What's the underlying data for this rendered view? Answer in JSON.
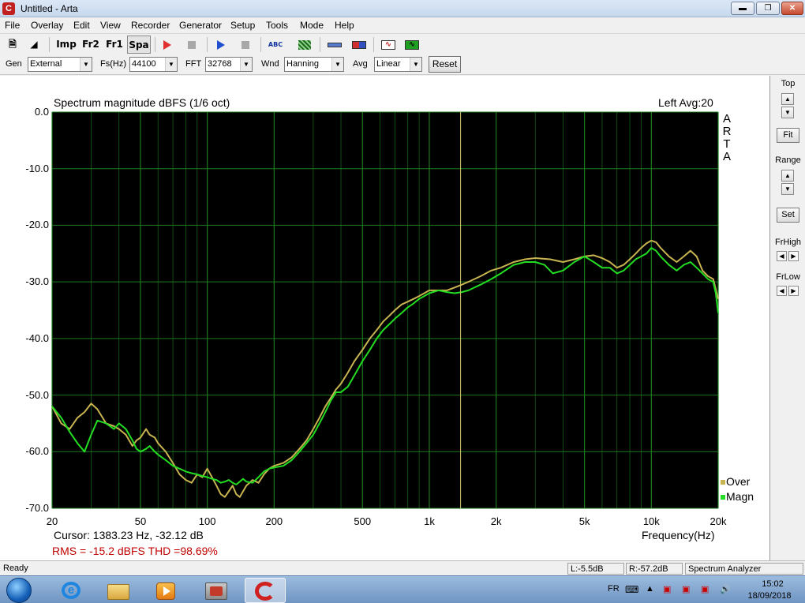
{
  "window": {
    "title": "Untitled - Arta",
    "app_icon": "arta-logo-icon"
  },
  "menu": [
    "File",
    "Overlay",
    "Edit",
    "View",
    "Recorder",
    "Generator",
    "Setup",
    "Tools",
    "Mode",
    "Help"
  ],
  "toolbar": {
    "imp_label": "Imp",
    "fr2_label": "Fr2",
    "fr1_label": "Fr1",
    "spa_label": "Spa",
    "abc_label": "ABC"
  },
  "controls": {
    "gen_label": "Gen",
    "gen_value": "External",
    "fs_label": "Fs(Hz)",
    "fs_value": "44100",
    "fft_label": "FFT",
    "fft_value": "32768",
    "wnd_label": "Wnd",
    "wnd_value": "Hanning",
    "avg_label": "Avg",
    "avg_value": "Linear",
    "reset_label": "Reset"
  },
  "plot": {
    "title": "Spectrum magnitude dBFS (1/6 oct)",
    "channel": "Left  Avg:20",
    "logo_letters": [
      "A",
      "R",
      "T",
      "A"
    ],
    "cursor_readout": "Cursor:  1383.23 Hz, -32.12 dB",
    "rms_readout": "RMS =  -15.2 dBFS   THD =98.69%",
    "colors": {
      "background": "#000000",
      "grid": "#1e7a1e",
      "over": "#c8b450",
      "magn": "#22dd22",
      "cursor": "#d8c870"
    }
  },
  "chart_data": {
    "type": "line",
    "title": "Spectrum magnitude dBFS (1/6 oct)",
    "xlabel": "Frequency(Hz)",
    "ylabel": "",
    "x_scale": "log",
    "xlim": [
      20,
      20000
    ],
    "ylim": [
      -70,
      0
    ],
    "x_ticks": [
      20,
      50,
      100,
      200,
      500,
      1000,
      2000,
      5000,
      10000,
      20000
    ],
    "x_tick_labels": [
      "20",
      "50",
      "100",
      "200",
      "500",
      "1k",
      "2k",
      "5k",
      "10k",
      "20k"
    ],
    "y_ticks": [
      0,
      -10,
      -20,
      -30,
      -40,
      -50,
      -60,
      -70
    ],
    "y_tick_labels": [
      "0.0",
      "-10.0",
      "-20.0",
      "-30.0",
      "-40.0",
      "-50.0",
      "-60.0",
      "-70.0"
    ],
    "grid": true,
    "legend_position": "bottom-right",
    "cursor_x": 1383.23,
    "series": [
      {
        "name": "Over",
        "color": "#c8b450",
        "points": [
          [
            20,
            -52
          ],
          [
            22,
            -55
          ],
          [
            24,
            -56
          ],
          [
            26,
            -54
          ],
          [
            28,
            -53
          ],
          [
            30,
            -51.5
          ],
          [
            32,
            -52.5
          ],
          [
            35,
            -55
          ],
          [
            38,
            -55.5
          ],
          [
            40,
            -56
          ],
          [
            43,
            -57
          ],
          [
            46,
            -59
          ],
          [
            48,
            -58
          ],
          [
            50,
            -57.5
          ],
          [
            53,
            -56
          ],
          [
            55,
            -57
          ],
          [
            58,
            -57.5
          ],
          [
            60,
            -58.5
          ],
          [
            65,
            -60
          ],
          [
            70,
            -62
          ],
          [
            75,
            -64
          ],
          [
            80,
            -65
          ],
          [
            85,
            -65.5
          ],
          [
            90,
            -64
          ],
          [
            95,
            -64.5
          ],
          [
            100,
            -63
          ],
          [
            105,
            -64.5
          ],
          [
            110,
            -66
          ],
          [
            115,
            -67.5
          ],
          [
            120,
            -68
          ],
          [
            125,
            -67
          ],
          [
            130,
            -66
          ],
          [
            135,
            -67.5
          ],
          [
            140,
            -68
          ],
          [
            145,
            -67
          ],
          [
            150,
            -66
          ],
          [
            160,
            -65
          ],
          [
            170,
            -65.5
          ],
          [
            180,
            -64
          ],
          [
            190,
            -63
          ],
          [
            200,
            -62.5
          ],
          [
            220,
            -62
          ],
          [
            240,
            -61
          ],
          [
            260,
            -59.5
          ],
          [
            280,
            -58
          ],
          [
            300,
            -56
          ],
          [
            320,
            -54
          ],
          [
            340,
            -52
          ],
          [
            360,
            -50.5
          ],
          [
            380,
            -49
          ],
          [
            400,
            -48
          ],
          [
            430,
            -46
          ],
          [
            460,
            -44
          ],
          [
            500,
            -42
          ],
          [
            540,
            -40
          ],
          [
            580,
            -38.5
          ],
          [
            620,
            -37
          ],
          [
            660,
            -36
          ],
          [
            700,
            -35
          ],
          [
            750,
            -34
          ],
          [
            800,
            -33.5
          ],
          [
            850,
            -33
          ],
          [
            900,
            -32.5
          ],
          [
            1000,
            -31.5
          ],
          [
            1100,
            -31.5
          ],
          [
            1200,
            -31.5
          ],
          [
            1300,
            -31
          ],
          [
            1400,
            -30.5
          ],
          [
            1500,
            -30
          ],
          [
            1700,
            -29
          ],
          [
            1900,
            -28
          ],
          [
            2100,
            -27.5
          ],
          [
            2400,
            -26.5
          ],
          [
            2700,
            -26
          ],
          [
            3000,
            -25.8
          ],
          [
            3500,
            -26
          ],
          [
            4000,
            -26.5
          ],
          [
            4500,
            -26
          ],
          [
            5000,
            -25.5
          ],
          [
            5500,
            -25.3
          ],
          [
            6000,
            -25.8
          ],
          [
            6500,
            -26.5
          ],
          [
            7000,
            -27.5
          ],
          [
            7500,
            -27
          ],
          [
            8000,
            -26
          ],
          [
            8500,
            -25
          ],
          [
            9000,
            -24
          ],
          [
            9500,
            -23.2
          ],
          [
            10000,
            -22.7
          ],
          [
            10500,
            -23
          ],
          [
            11000,
            -24
          ],
          [
            12000,
            -25.5
          ],
          [
            13000,
            -26.5
          ],
          [
            14000,
            -25.5
          ],
          [
            15000,
            -24.5
          ],
          [
            16000,
            -25.5
          ],
          [
            17000,
            -28
          ],
          [
            18000,
            -29
          ],
          [
            19000,
            -29.5
          ],
          [
            20000,
            -33
          ]
        ]
      },
      {
        "name": "Magn",
        "color": "#22dd22",
        "points": [
          [
            20,
            -52
          ],
          [
            22,
            -54
          ],
          [
            24,
            -56.5
          ],
          [
            26,
            -58.5
          ],
          [
            28,
            -60
          ],
          [
            30,
            -57
          ],
          [
            32,
            -54.5
          ],
          [
            35,
            -55
          ],
          [
            38,
            -56
          ],
          [
            40,
            -55
          ],
          [
            43,
            -56
          ],
          [
            46,
            -58
          ],
          [
            48,
            -59.5
          ],
          [
            50,
            -60
          ],
          [
            53,
            -59.5
          ],
          [
            55,
            -59
          ],
          [
            58,
            -60
          ],
          [
            60,
            -60.5
          ],
          [
            65,
            -61.5
          ],
          [
            70,
            -62.5
          ],
          [
            75,
            -63
          ],
          [
            80,
            -63.5
          ],
          [
            85,
            -63.8
          ],
          [
            90,
            -64
          ],
          [
            95,
            -64.3
          ],
          [
            100,
            -64.5
          ],
          [
            105,
            -64.8
          ],
          [
            110,
            -65
          ],
          [
            115,
            -65.5
          ],
          [
            120,
            -65.3
          ],
          [
            125,
            -65
          ],
          [
            130,
            -65.5
          ],
          [
            135,
            -65.8
          ],
          [
            140,
            -65.3
          ],
          [
            145,
            -64.8
          ],
          [
            150,
            -65.3
          ],
          [
            160,
            -65.5
          ],
          [
            170,
            -64.5
          ],
          [
            180,
            -63.5
          ],
          [
            190,
            -63
          ],
          [
            200,
            -62.8
          ],
          [
            220,
            -62.5
          ],
          [
            240,
            -61.5
          ],
          [
            260,
            -60
          ],
          [
            280,
            -58.5
          ],
          [
            300,
            -57
          ],
          [
            320,
            -55
          ],
          [
            340,
            -53
          ],
          [
            360,
            -51
          ],
          [
            380,
            -49.5
          ],
          [
            400,
            -49.5
          ],
          [
            430,
            -48.5
          ],
          [
            460,
            -46.5
          ],
          [
            500,
            -44
          ],
          [
            540,
            -42
          ],
          [
            580,
            -40
          ],
          [
            620,
            -38.5
          ],
          [
            660,
            -37.5
          ],
          [
            700,
            -36.5
          ],
          [
            750,
            -35.5
          ],
          [
            800,
            -34.5
          ],
          [
            850,
            -33.8
          ],
          [
            900,
            -33
          ],
          [
            1000,
            -32
          ],
          [
            1100,
            -31.5
          ],
          [
            1200,
            -31.8
          ],
          [
            1300,
            -32
          ],
          [
            1400,
            -31.8
          ],
          [
            1500,
            -31.5
          ],
          [
            1700,
            -30.5
          ],
          [
            1900,
            -29.5
          ],
          [
            2100,
            -28.5
          ],
          [
            2400,
            -27
          ],
          [
            2700,
            -26.5
          ],
          [
            3000,
            -26.5
          ],
          [
            3300,
            -27
          ],
          [
            3600,
            -28.5
          ],
          [
            4000,
            -28
          ],
          [
            4500,
            -26.5
          ],
          [
            5000,
            -25.5
          ],
          [
            5500,
            -26.5
          ],
          [
            6000,
            -27.5
          ],
          [
            6500,
            -27.5
          ],
          [
            7000,
            -28.5
          ],
          [
            7500,
            -28
          ],
          [
            8000,
            -27
          ],
          [
            8500,
            -26
          ],
          [
            9000,
            -25.5
          ],
          [
            9500,
            -25
          ],
          [
            10000,
            -24
          ],
          [
            10500,
            -24.5
          ],
          [
            11000,
            -25.5
          ],
          [
            12000,
            -27
          ],
          [
            13000,
            -28
          ],
          [
            14000,
            -27
          ],
          [
            15000,
            -26.5
          ],
          [
            16000,
            -27.5
          ],
          [
            17000,
            -28.5
          ],
          [
            18000,
            -29.5
          ],
          [
            19000,
            -30
          ],
          [
            19500,
            -32
          ],
          [
            20000,
            -35.5
          ]
        ]
      }
    ]
  },
  "side": {
    "top_label": "Top",
    "fit_label": "Fit",
    "range_label": "Range",
    "set_label": "Set",
    "frhigh_label": "FrHigh",
    "frlow_label": "FrLow"
  },
  "status": {
    "ready": "Ready",
    "left_level": "L:-5.5dB",
    "right_level": "R:-57.2dB",
    "mode": "Spectrum Analyzer"
  },
  "taskbar": {
    "language": "FR",
    "time": "15:02",
    "date": "18/09/2018"
  }
}
